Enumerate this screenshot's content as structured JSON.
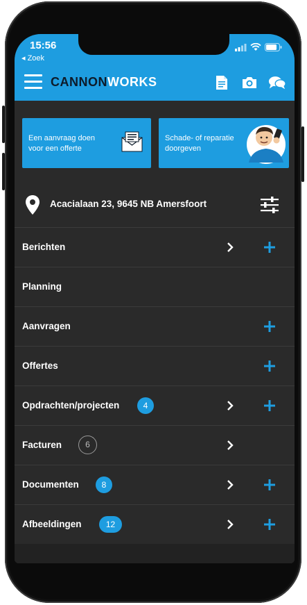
{
  "status_bar": {
    "time": "15:56",
    "back_label": "◂ Zoek"
  },
  "app": {
    "logo_part1": "CANNON",
    "logo_part2": "WORKS"
  },
  "cards": [
    {
      "text": "Een aanvraag doen voor een offerte",
      "icon": "envelope-icon"
    },
    {
      "text": "Schade- of reparatie doorgeven",
      "icon": "mechanic-avatar"
    }
  ],
  "address": {
    "text": "Acacialaan 23, 9645 NB Amersfoort"
  },
  "menu": [
    {
      "label": "Berichten",
      "badge": "",
      "chevron": true,
      "plus": true
    },
    {
      "label": "Planning",
      "badge": "",
      "chevron": false,
      "plus": false
    },
    {
      "label": "Aanvragen",
      "badge": "",
      "chevron": false,
      "plus": true
    },
    {
      "label": "Offertes",
      "badge": "",
      "chevron": false,
      "plus": true
    },
    {
      "label": "Opdrachten/projecten",
      "badge": "4",
      "chevron": true,
      "plus": true
    },
    {
      "label": "Facturen",
      "badge": "6",
      "badge_style": "outline",
      "chevron": true,
      "plus": false
    },
    {
      "label": "Documenten",
      "badge": "8",
      "chevron": true,
      "plus": true
    },
    {
      "label": "Afbeeldingen",
      "badge": "12",
      "chevron": true,
      "plus": true
    }
  ],
  "colors": {
    "accent": "#1e9de0",
    "background": "#2a2a2a",
    "logo_dark": "#0d1b2a"
  }
}
